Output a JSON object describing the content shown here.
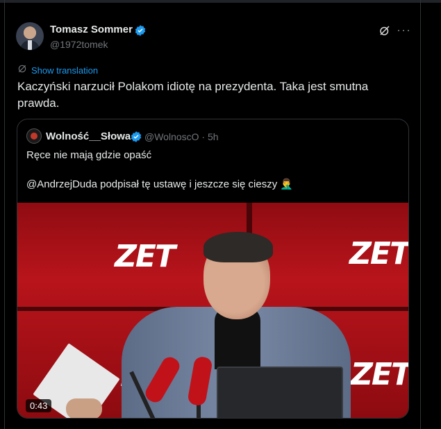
{
  "post": {
    "author_name": "Tomasz Sommer",
    "author_handle": "@1972tomek",
    "show_translation": "Show translation",
    "text": "Kaczyński narzucił Polakom idiotę na prezydenta. Taka jest smutna prawda."
  },
  "quoted": {
    "author_name": "Wolność__Słowa",
    "author_handle": "@WolnoscO · 5h",
    "line1": "Ręce nie mają gdzie opaść",
    "line2": "@AndrzejDuda podpisał tę ustawę i jeszcze się cieszy 🤦‍♂️",
    "video_duration": "0:43",
    "video_logo": "ZET"
  },
  "colors": {
    "accent": "#1d9bf0",
    "muted": "#71767b",
    "text": "#e7e9ea",
    "background": "#000000",
    "video_red": "#b8141b"
  },
  "icons": [
    "verified-badge-icon",
    "grok-icon",
    "more-icon",
    "translate-icon"
  ]
}
